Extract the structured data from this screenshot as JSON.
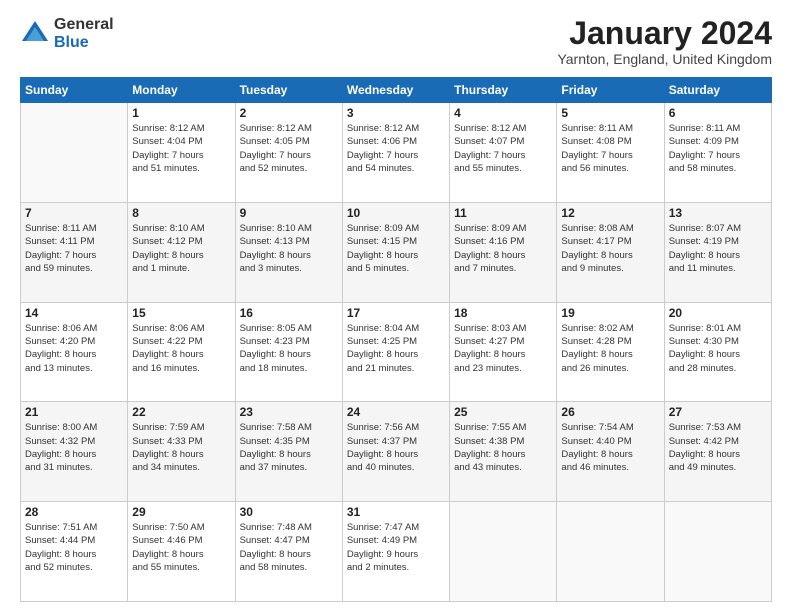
{
  "header": {
    "logo_general": "General",
    "logo_blue": "Blue",
    "month_title": "January 2024",
    "location": "Yarnton, England, United Kingdom"
  },
  "calendar": {
    "days_of_week": [
      "Sunday",
      "Monday",
      "Tuesday",
      "Wednesday",
      "Thursday",
      "Friday",
      "Saturday"
    ],
    "weeks": [
      [
        {
          "day": "",
          "info": ""
        },
        {
          "day": "1",
          "info": "Sunrise: 8:12 AM\nSunset: 4:04 PM\nDaylight: 7 hours\nand 51 minutes."
        },
        {
          "day": "2",
          "info": "Sunrise: 8:12 AM\nSunset: 4:05 PM\nDaylight: 7 hours\nand 52 minutes."
        },
        {
          "day": "3",
          "info": "Sunrise: 8:12 AM\nSunset: 4:06 PM\nDaylight: 7 hours\nand 54 minutes."
        },
        {
          "day": "4",
          "info": "Sunrise: 8:12 AM\nSunset: 4:07 PM\nDaylight: 7 hours\nand 55 minutes."
        },
        {
          "day": "5",
          "info": "Sunrise: 8:11 AM\nSunset: 4:08 PM\nDaylight: 7 hours\nand 56 minutes."
        },
        {
          "day": "6",
          "info": "Sunrise: 8:11 AM\nSunset: 4:09 PM\nDaylight: 7 hours\nand 58 minutes."
        }
      ],
      [
        {
          "day": "7",
          "info": "Sunrise: 8:11 AM\nSunset: 4:11 PM\nDaylight: 7 hours\nand 59 minutes."
        },
        {
          "day": "8",
          "info": "Sunrise: 8:10 AM\nSunset: 4:12 PM\nDaylight: 8 hours\nand 1 minute."
        },
        {
          "day": "9",
          "info": "Sunrise: 8:10 AM\nSunset: 4:13 PM\nDaylight: 8 hours\nand 3 minutes."
        },
        {
          "day": "10",
          "info": "Sunrise: 8:09 AM\nSunset: 4:15 PM\nDaylight: 8 hours\nand 5 minutes."
        },
        {
          "day": "11",
          "info": "Sunrise: 8:09 AM\nSunset: 4:16 PM\nDaylight: 8 hours\nand 7 minutes."
        },
        {
          "day": "12",
          "info": "Sunrise: 8:08 AM\nSunset: 4:17 PM\nDaylight: 8 hours\nand 9 minutes."
        },
        {
          "day": "13",
          "info": "Sunrise: 8:07 AM\nSunset: 4:19 PM\nDaylight: 8 hours\nand 11 minutes."
        }
      ],
      [
        {
          "day": "14",
          "info": "Sunrise: 8:06 AM\nSunset: 4:20 PM\nDaylight: 8 hours\nand 13 minutes."
        },
        {
          "day": "15",
          "info": "Sunrise: 8:06 AM\nSunset: 4:22 PM\nDaylight: 8 hours\nand 16 minutes."
        },
        {
          "day": "16",
          "info": "Sunrise: 8:05 AM\nSunset: 4:23 PM\nDaylight: 8 hours\nand 18 minutes."
        },
        {
          "day": "17",
          "info": "Sunrise: 8:04 AM\nSunset: 4:25 PM\nDaylight: 8 hours\nand 21 minutes."
        },
        {
          "day": "18",
          "info": "Sunrise: 8:03 AM\nSunset: 4:27 PM\nDaylight: 8 hours\nand 23 minutes."
        },
        {
          "day": "19",
          "info": "Sunrise: 8:02 AM\nSunset: 4:28 PM\nDaylight: 8 hours\nand 26 minutes."
        },
        {
          "day": "20",
          "info": "Sunrise: 8:01 AM\nSunset: 4:30 PM\nDaylight: 8 hours\nand 28 minutes."
        }
      ],
      [
        {
          "day": "21",
          "info": "Sunrise: 8:00 AM\nSunset: 4:32 PM\nDaylight: 8 hours\nand 31 minutes."
        },
        {
          "day": "22",
          "info": "Sunrise: 7:59 AM\nSunset: 4:33 PM\nDaylight: 8 hours\nand 34 minutes."
        },
        {
          "day": "23",
          "info": "Sunrise: 7:58 AM\nSunset: 4:35 PM\nDaylight: 8 hours\nand 37 minutes."
        },
        {
          "day": "24",
          "info": "Sunrise: 7:56 AM\nSunset: 4:37 PM\nDaylight: 8 hours\nand 40 minutes."
        },
        {
          "day": "25",
          "info": "Sunrise: 7:55 AM\nSunset: 4:38 PM\nDaylight: 8 hours\nand 43 minutes."
        },
        {
          "day": "26",
          "info": "Sunrise: 7:54 AM\nSunset: 4:40 PM\nDaylight: 8 hours\nand 46 minutes."
        },
        {
          "day": "27",
          "info": "Sunrise: 7:53 AM\nSunset: 4:42 PM\nDaylight: 8 hours\nand 49 minutes."
        }
      ],
      [
        {
          "day": "28",
          "info": "Sunrise: 7:51 AM\nSunset: 4:44 PM\nDaylight: 8 hours\nand 52 minutes."
        },
        {
          "day": "29",
          "info": "Sunrise: 7:50 AM\nSunset: 4:46 PM\nDaylight: 8 hours\nand 55 minutes."
        },
        {
          "day": "30",
          "info": "Sunrise: 7:48 AM\nSunset: 4:47 PM\nDaylight: 8 hours\nand 58 minutes."
        },
        {
          "day": "31",
          "info": "Sunrise: 7:47 AM\nSunset: 4:49 PM\nDaylight: 9 hours\nand 2 minutes."
        },
        {
          "day": "",
          "info": ""
        },
        {
          "day": "",
          "info": ""
        },
        {
          "day": "",
          "info": ""
        }
      ]
    ]
  }
}
